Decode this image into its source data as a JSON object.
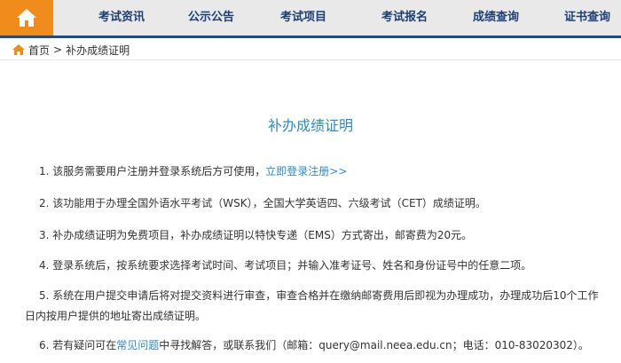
{
  "nav": {
    "items": [
      "考试资讯",
      "公示公告",
      "考试项目",
      "考试报名",
      "成绩查询",
      "证书查询"
    ]
  },
  "breadcrumb": {
    "home": "首页",
    "separator": ">",
    "current": "补办成绩证明"
  },
  "main": {
    "title": "补办成绩证明",
    "items": [
      {
        "pre": "1. 该服务需要用户注册并登录系统后方可使用，",
        "link": "立即登录注册>>",
        "post": ""
      },
      {
        "pre": "2. 该功能用于办理全国外语水平考试（WSK），全国大学英语四、六级考试（CET）成绩证明。",
        "link": "",
        "post": ""
      },
      {
        "pre": "3. 补办成绩证明为免费项目，补办成绩证明以特快专递（EMS）方式寄出，邮寄费为20元。",
        "link": "",
        "post": ""
      },
      {
        "pre": "4. 登录系统后，按系统要求选择考试时间、考试项目；并输入准考证号、姓名和身份证号中的任意二项。",
        "link": "",
        "post": ""
      },
      {
        "pre": "5. 系统在用户提交申请后将对提交资料进行审查，审查合格并在缴纳邮寄费用后即视为办理成功，办理成功后10个工作日内按用户提供的地址寄出成绩证明。",
        "link": "",
        "post": ""
      },
      {
        "pre": "6. 若有疑问可在",
        "link": "常见问题",
        "post": "中寻找解答，或联系我们（邮箱：query@mail.neea.edu.cn；电话：010-83020302）。"
      }
    ]
  },
  "colors": {
    "accent_orange": "#f08c1c",
    "nav_text": "#1d3f73",
    "nav_border": "#1b4b8f",
    "link_blue": "#2a8ad0"
  },
  "icons": {
    "home_button": "home-icon",
    "breadcrumb_home": "home-icon"
  }
}
